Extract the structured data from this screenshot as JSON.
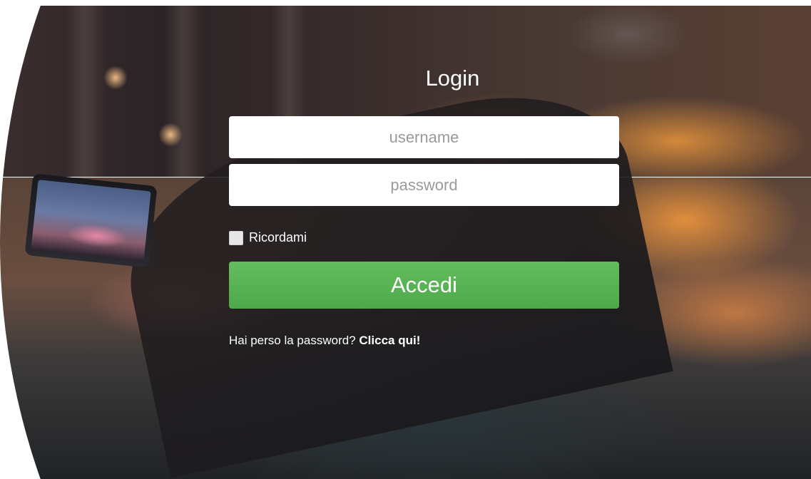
{
  "login": {
    "title": "Login",
    "username_placeholder": "username",
    "password_placeholder": "password",
    "remember_label": "Ricordami",
    "submit_label": "Accedi",
    "forgot_text": "Hai perso la password?",
    "forgot_link": "Clicca qui!"
  },
  "colors": {
    "accent_green": "#5cb85c",
    "text_on_photo": "#ffffff"
  }
}
